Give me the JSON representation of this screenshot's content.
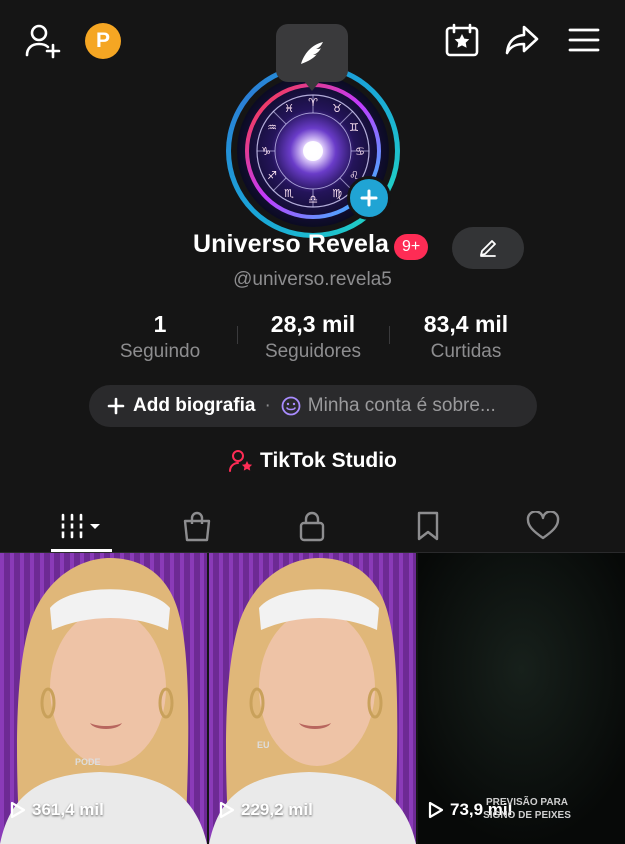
{
  "profile": {
    "name": "Universo Revela",
    "notification_badge": "9+",
    "handle": "@universo.revela5",
    "coin_label": "P"
  },
  "stats": [
    {
      "value": "1",
      "label": "Seguindo"
    },
    {
      "value": "28,3 mil",
      "label": "Seguidores"
    },
    {
      "value": "83,4 mil",
      "label": "Curtidas"
    }
  ],
  "bio": {
    "add_label": "Add biografia",
    "separator": "·",
    "suggestion": "Minha conta é sobre..."
  },
  "studio": {
    "label": "TikTok Studio"
  },
  "tabs": [
    "videos-icon",
    "shop-icon",
    "lock-icon",
    "bookmark-icon",
    "heart-icon"
  ],
  "videos": [
    {
      "views": "361,4 mil",
      "overlay_text": "PODE"
    },
    {
      "views": "229,2 mil",
      "overlay_text": "EU"
    },
    {
      "views": "73,9 mil",
      "caption": "PREVISÃO PARA SIGNO DE PEIXES"
    }
  ],
  "colors": {
    "accent_red": "#fe2c55",
    "ring_blue": "#20a4d4",
    "coin_orange": "#f5a623",
    "background": "#151515"
  }
}
